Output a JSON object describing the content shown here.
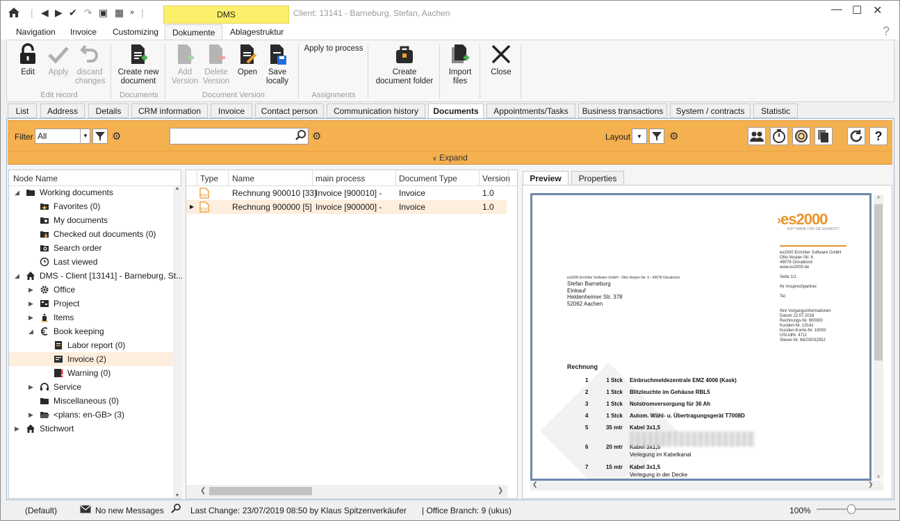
{
  "titlebar": {
    "ribbon_context_tab": "DMS",
    "client_title": "Client: 13141 - Barneburg, Stefan, Aachen"
  },
  "ribbon_tabs": [
    "Navigation",
    "Invoice",
    "Customizing",
    "Dokumente",
    "Ablagestruktur"
  ],
  "ribbon": {
    "edit": "Edit",
    "apply": "Apply",
    "discard_l1": "discard",
    "discard_l2": "changes",
    "group_edit": "Edit record",
    "create_doc_l1": "Create new",
    "create_doc_l2": "document",
    "group_docs": "Documents",
    "add_l1": "Add",
    "add_l2": "Version",
    "delete_l1": "Delete",
    "delete_l2": "Version",
    "open": "Open",
    "save_l1": "Save",
    "save_l2": "locally",
    "group_version": "Document Version",
    "apply_process": "Apply to process",
    "group_assign": "Assignments",
    "folder_l1": "Create",
    "folder_l2": "document folder",
    "import_l1": "Import",
    "import_l2": "files",
    "close": "Close"
  },
  "content_tabs": [
    "List",
    "Address",
    "Details",
    "CRM information",
    "Invoice",
    "Contact person",
    "Communication history",
    "Documents",
    "Appointments/Tasks",
    "Business transactions",
    "System / contracts",
    "Statistic"
  ],
  "filterbar": {
    "filter_label": "Filter",
    "filter_value": "All",
    "layout_label": "Layout",
    "expand": "Expand"
  },
  "tree": {
    "header": "Node Name",
    "rows": [
      {
        "label": "Working documents"
      },
      {
        "label": "Favorites (0)"
      },
      {
        "label": "My documents"
      },
      {
        "label": "Checked out documents (0)"
      },
      {
        "label": "Search order"
      },
      {
        "label": "Last viewed"
      },
      {
        "label": "DMS - Client [13141] - Barneburg, St..."
      },
      {
        "label": "Office"
      },
      {
        "label": "Project"
      },
      {
        "label": "Items"
      },
      {
        "label": "Book keeping"
      },
      {
        "label": "Labor report (0)"
      },
      {
        "label": "Invoice (2)"
      },
      {
        "label": "Warning (0)"
      },
      {
        "label": "Service"
      },
      {
        "label": "Miscellaneous (0)"
      },
      {
        "label": "<plans: en-GB> (3)"
      },
      {
        "label": "Stichwort"
      }
    ]
  },
  "grid": {
    "headers": [
      "Type",
      "Name",
      "main process",
      "Document Type",
      "Version"
    ],
    "rows": [
      {
        "name": "Rechnung 900010 [33]",
        "process": "Invoice [900010] -",
        "doctype": "Invoice",
        "version": "1.0"
      },
      {
        "name": "Rechnung 900000 [5]",
        "process": "Invoice [900000] -",
        "doctype": "Invoice",
        "version": "1.0"
      }
    ]
  },
  "preview": {
    "tabs": [
      "Preview",
      "Properties"
    ],
    "logo": "es2000",
    "logo_sub": "SOFTWARE FÜR SIE GEMACHT",
    "sender_line": "es2000 Errichter Software GmbH - Otto-Vesper-Str. 6 - 49078 Osnabrück",
    "company_block": [
      "es2000 Errichter Software GmbH",
      "Otto-Vesper-Str. 6",
      "49078 Osnabrück",
      "www.es2000.de"
    ],
    "page": "Seite 1/1",
    "contact": "Ihr Ansprechpartner:",
    "tel": "Tel.",
    "info_block": [
      "Ihre Vorgangsinformationen",
      "Datum 12.07.2018",
      "Rechnungs-Nr. 900000",
      "Kunden-Nr. 13141",
      "Kunden-Konto-Nr. 10003",
      "USt-IdNr. 4711",
      "Steuer-Nr. 66/200/32552"
    ],
    "address": [
      "Stefan Barneburg",
      "Einkauf",
      "Heldenheimer Str. 378",
      "52062 Aachen"
    ],
    "heading": "Rechnung",
    "lines": [
      {
        "pos": "1",
        "qty": "1 Stck",
        "text": "Einbruchmeldezentrale EMZ 4006 (Kask)"
      },
      {
        "pos": "2",
        "qty": "1 Stck",
        "text": "Blitzleuchte im Gehäuse RBL5"
      },
      {
        "pos": "3",
        "qty": "1 Stck",
        "text": "Notstromversorgung für 36 Ah"
      },
      {
        "pos": "4",
        "qty": "1 Stck",
        "text": "Autom. Wähl- u. Übertragungsgerät T7008D"
      },
      {
        "pos": "5",
        "qty": "35 mtr",
        "text": "Kabel 3x1,5"
      },
      {
        "pos": "6",
        "qty": "20 mtr",
        "text": "Kabel 3x1,5",
        "sub": "Verlegung im Kabelkanal"
      },
      {
        "pos": "7",
        "qty": "15 mtr",
        "text": "Kabel 3x1,5",
        "sub": "Verlegung in der Decke"
      }
    ]
  },
  "status": {
    "profile": "(Default)",
    "messages": "No new Messages",
    "last_change": "Last Change: 23/07/2019 08:50 by Klaus Spitzenverkäufer",
    "branch": "| Office Branch:  9 (ukus)",
    "zoom": "100%"
  },
  "colors": {
    "accent": "#f5b04f",
    "context_tab": "#fcf06a",
    "selection": "#fdeedd",
    "frame": "#6f87ad"
  }
}
